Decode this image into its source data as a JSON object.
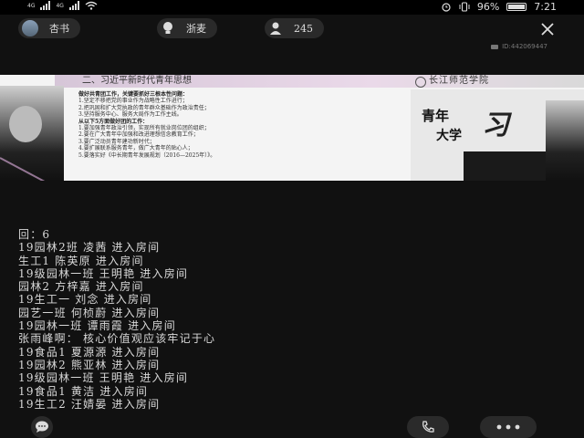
{
  "status_bar": {
    "network_1": "4G",
    "network_2": "4G",
    "battery_percent": "96%",
    "battery_level": 0.96,
    "time": "7:21"
  },
  "host": {
    "name": "杏书"
  },
  "room": {
    "name": "浙麦",
    "viewer_count": "245",
    "id": "ID:442069447"
  },
  "slide": {
    "title": "二、习近平新时代青年思想",
    "school": "长江师范学院",
    "lines": [
      {
        "text": "做好共青团工作，关键要抓好三根本性问题：",
        "heading": true
      },
      {
        "text": "1.坚定不移把党的事业作为战略性工作进行；",
        "heading": false
      },
      {
        "text": "2.把巩固和扩大党执政的青年群众基础作为政治责任；",
        "heading": false
      },
      {
        "text": "3.坚持服务中心、服务大局作为工作主线。",
        "heading": false
      },
      {
        "text": "从以下5方面做好团的工作：",
        "heading": true
      },
      {
        "text": "1.要加强青年政治引领，实现所有就业岗位团的组织；",
        "heading": false
      },
      {
        "text": "2.要在广大青年中加强和改进理想信念教育工作；",
        "heading": false
      },
      {
        "text": "3.要广泛动员青年建功新时代；",
        "heading": false
      },
      {
        "text": "4.要扩展联系服务青年，做广大青年的贴心人；",
        "heading": false
      },
      {
        "text": "5.要落实好《中长期青年发展规划（2016—2025年）》。",
        "heading": false
      }
    ],
    "poster_line1": "青年",
    "poster_line2": "大学",
    "poster_big": "习"
  },
  "chat": [
    "回：6",
    "19园林2班 凌茜 进入房间",
    "生工1 陈英原 进入房间",
    "19级园林一班 王明艳 进入房间",
    "园林2 方梓嘉 进入房间",
    "19生工一 刘念 进入房间",
    "园艺一班 何桢蔚 进入房间",
    "19园林一班 谭雨霞 进入房间",
    "张雨峰啊：  核心价值观应该牢记于心",
    "19食品1 夏源源 进入房间",
    "19园林2 熊亚林 进入房间",
    "19级园林一班 王明艳 进入房间",
    "19食品1 黄洁 进入房间",
    "19生工2 汪婧晏 进入房间"
  ]
}
